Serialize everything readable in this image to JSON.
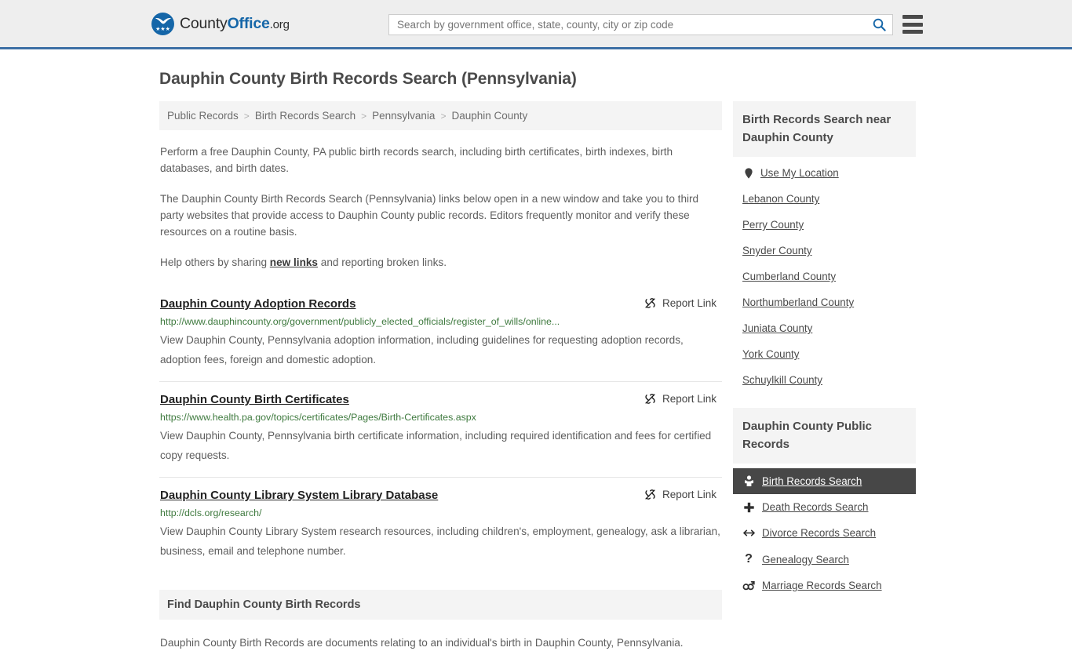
{
  "header": {
    "brand": {
      "part1": "County",
      "part2": "Office",
      "part3": ".org"
    },
    "search": {
      "placeholder": "Search by government office, state, county, city or zip code",
      "value": ""
    }
  },
  "page": {
    "title": "Dauphin County Birth Records Search (Pennsylvania)"
  },
  "breadcrumb": {
    "separator": ">",
    "items": [
      {
        "label": "Public Records"
      },
      {
        "label": "Birth Records Search"
      },
      {
        "label": "Pennsylvania"
      },
      {
        "label": "Dauphin County"
      }
    ]
  },
  "intro": {
    "p1": "Perform a free Dauphin County, PA public birth records search, including birth certificates, birth indexes, birth databases, and birth dates.",
    "p2": "The Dauphin County Birth Records Search (Pennsylvania) links below open in a new window and take you to third party websites that provide access to Dauphin County public records. Editors frequently monitor and verify these resources on a routine basis.",
    "p3_before": "Help others by sharing ",
    "p3_link": "new links",
    "p3_after": " and reporting broken links."
  },
  "results": {
    "report_label": "Report Link",
    "items": [
      {
        "title": "Dauphin County Adoption Records",
        "url": "http://www.dauphincounty.org/government/publicly_elected_officials/register_of_wills/online...",
        "description": "View Dauphin County, Pennsylvania adoption information, including guidelines for requesting adoption records, adoption fees, foreign and domestic adoption."
      },
      {
        "title": "Dauphin County Birth Certificates",
        "url": "https://www.health.pa.gov/topics/certificates/Pages/Birth-Certificates.aspx",
        "description": "View Dauphin County, Pennsylvania birth certificate information, including required identification and fees for certified copy requests."
      },
      {
        "title": "Dauphin County Library System Library Database",
        "url": "http://dcls.org/research/",
        "description": "View Dauphin County Library System research resources, including children's, employment, genealogy, ask a librarian, business, email and telephone number."
      }
    ]
  },
  "find_section": {
    "header": "Find Dauphin County Birth Records",
    "body": "Dauphin County Birth Records are documents relating to an individual's birth in Dauphin County, Pennsylvania."
  },
  "sidebar": {
    "nearby": {
      "header": "Birth Records Search near Dauphin County",
      "use_my_location": "Use My Location",
      "counties": [
        {
          "label": "Lebanon County"
        },
        {
          "label": "Perry County"
        },
        {
          "label": "Snyder County"
        },
        {
          "label": "Cumberland County"
        },
        {
          "label": "Northumberland County"
        },
        {
          "label": "Juniata County"
        },
        {
          "label": "York County"
        },
        {
          "label": "Schuylkill County"
        }
      ]
    },
    "public_records": {
      "header": "Dauphin County Public Records",
      "items": [
        {
          "label": "Birth Records Search",
          "icon": "baby-icon",
          "glyph": "👶",
          "active": true
        },
        {
          "label": "Death Records Search",
          "icon": "plus-icon",
          "glyph": "✚",
          "active": false
        },
        {
          "label": "Divorce Records Search",
          "icon": "arrows-horizontal-icon",
          "glyph": "↔",
          "active": false
        },
        {
          "label": "Genealogy Search",
          "icon": "question-mark-icon",
          "glyph": "?",
          "active": false
        },
        {
          "label": "Marriage Records Search",
          "icon": "male-female-icon",
          "glyph": "⚥",
          "active": false
        }
      ]
    }
  },
  "colors": {
    "brand_blue": "#1566a8",
    "header_rule": "#3d6fa5",
    "url_green": "#3f7a3f",
    "active_bg": "#474747",
    "panel_bg": "#f4f4f4"
  }
}
